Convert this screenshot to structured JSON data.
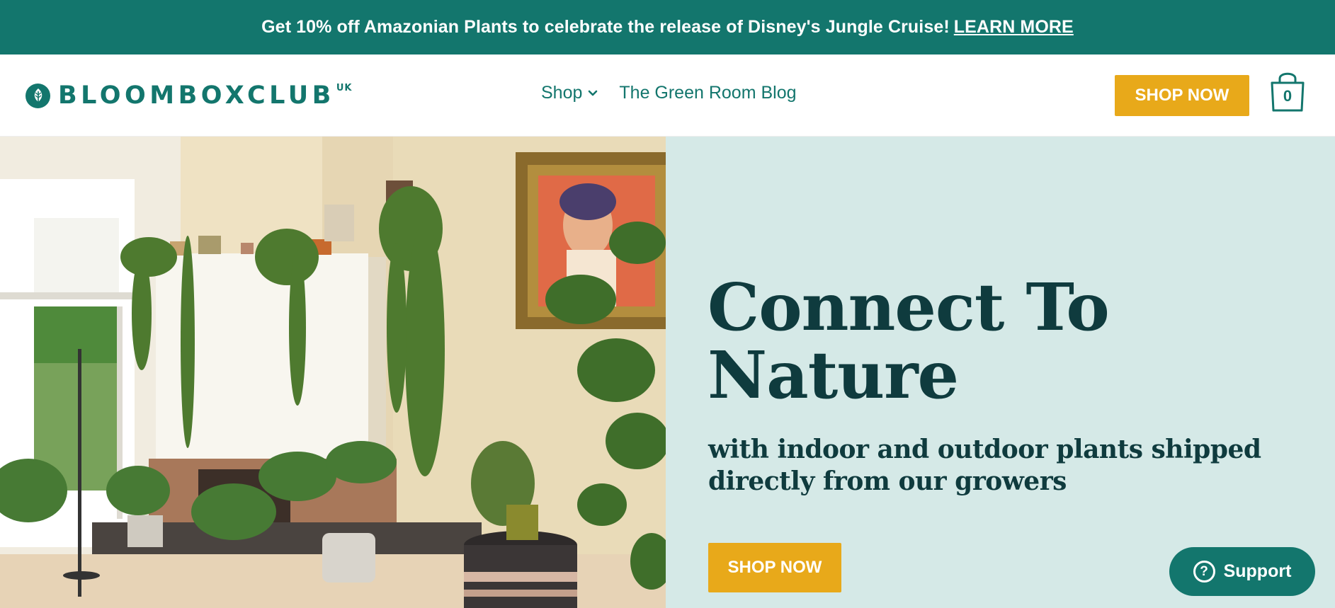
{
  "announcement": {
    "text": "Get 10% off Amazonian Plants to celebrate the release of Disney's Jungle Cruise!",
    "link_label": "LEARN MORE"
  },
  "header": {
    "logo_text": "BLOOMBOXCLUB",
    "logo_sup": "UK",
    "nav": [
      {
        "label": "Shop",
        "icon": "chevron-down-icon"
      },
      {
        "label": "The Green Room Blog"
      }
    ],
    "shop_button": "SHOP NOW",
    "cart": {
      "icon": "shopping-bag-icon",
      "count": "0"
    }
  },
  "hero": {
    "title_line1": "Connect To",
    "title_line2": "Nature",
    "subtitle": "with indoor and outdoor plants shipped directly from our growers",
    "shop_button": "SHOP NOW",
    "image_alt": "bright living room with trailing pothos plants, monstera, fiddle leaf fig and framed portrait painting"
  },
  "support": {
    "label": "Support",
    "icon": "question-circle-icon"
  },
  "colors": {
    "brand_teal": "#13766d",
    "cta_yellow": "#e8a91a",
    "hero_bg": "#d5e9e7",
    "heading": "#0f3b3e"
  }
}
